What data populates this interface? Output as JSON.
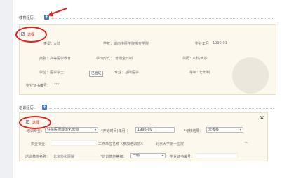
{
  "education": {
    "section_label": "教育经历：",
    "plus_icon": "plus-icon",
    "select_label": "选择",
    "fields": {
      "type_label": "类型：",
      "type_value": "大陆",
      "school_label": "学校：",
      "school_value": "湖南中医学院湘杏学院",
      "grad_label": "毕业年月：",
      "grad_value": "1990-01",
      "category_label": "类别：",
      "category_value": "高等医学教育",
      "study_form_label": "学习形式：",
      "study_form_value": "普通全日制",
      "edu_label": "学历：",
      "edu_value": "本科/大学",
      "degree_label": "学位：",
      "degree_value": "医学学士",
      "major_label": "专业：",
      "major_value": "基础医学",
      "schooling_label": "学制：",
      "schooling_value": "七年制",
      "cert_label": "毕业证书编号：",
      "cert_value": "***"
    },
    "verified_label": "已验证"
  },
  "training": {
    "section_label": "培训经历：",
    "plus_icon": "plus-icon",
    "select_label": "选择",
    "close_icon": "×",
    "fields": {
      "major_label": "培训专业：",
      "major_value": "住院医师规范化培训",
      "start_label": "*开始时间(年月)：",
      "start_value": "1996-09",
      "result_label": "*考核结果：",
      "result_value": "未考核",
      "practice_label": "执业专业：",
      "workplace_label": "工作单位名称（参加培训前）：",
      "workplace_value": "北京大学第一医院",
      "base_name_label": "培训基地名称：",
      "base_name_value": "北京协和医院",
      "base_level_label": "*培训基地等级：",
      "base_level_value": "一级",
      "cert_label": "毕业证书编号：",
      "more": "..."
    }
  }
}
